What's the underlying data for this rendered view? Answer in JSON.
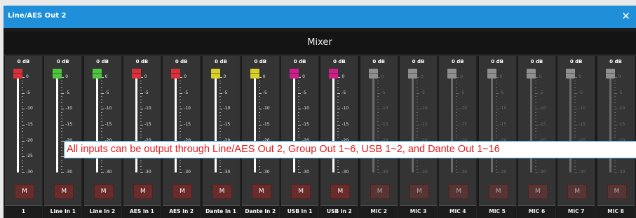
{
  "window": {
    "title": "Line/AES Out 2",
    "close_icon": "close-icon"
  },
  "mixer": {
    "title": "Mixer"
  },
  "scale_labels": [
    "0",
    "-5",
    "-10",
    "-15",
    "-20",
    "-25",
    "-30"
  ],
  "mute_label": "M",
  "note": "All inputs can be output through Line/AES Out 2, Group Out 1~6, USB 1~2, and Dante Out 1~16",
  "channels": [
    {
      "name": "1",
      "gain": "0 dB",
      "knob_color": "#d8313a",
      "active": true
    },
    {
      "name": "Line In 1",
      "gain": "0 dB",
      "knob_color": "#4ec53f",
      "active": true
    },
    {
      "name": "Line In 2",
      "gain": "0 dB",
      "knob_color": "#4ec53f",
      "active": true
    },
    {
      "name": "AES In 1",
      "gain": "0 dB",
      "knob_color": "#d8313a",
      "active": true
    },
    {
      "name": "AES In 2",
      "gain": "0 dB",
      "knob_color": "#d8313a",
      "active": true
    },
    {
      "name": "Dante In 1",
      "gain": "0 dB",
      "knob_color": "#d7cf2a",
      "active": true
    },
    {
      "name": "Dante In 2",
      "gain": "0 dB",
      "knob_color": "#d7cf2a",
      "active": true
    },
    {
      "name": "USB In 1",
      "gain": "0 dB",
      "knob_color": "#cc1f8c",
      "active": true
    },
    {
      "name": "USB In 2",
      "gain": "0 dB",
      "knob_color": "#cc1f8c",
      "active": true
    },
    {
      "name": "MIC 2",
      "gain": "0 dB",
      "knob_color": "#8f8f8f",
      "active": false
    },
    {
      "name": "MIC 3",
      "gain": "0 dB",
      "knob_color": "#8f8f8f",
      "active": false
    },
    {
      "name": "MIC 4",
      "gain": "0 dB",
      "knob_color": "#8f8f8f",
      "active": false
    },
    {
      "name": "MIC 5",
      "gain": "0 dB",
      "knob_color": "#8f8f8f",
      "active": false
    },
    {
      "name": "MIC 6",
      "gain": "0 dB",
      "knob_color": "#8f8f8f",
      "active": false
    },
    {
      "name": "MIC 7",
      "gain": "0 dB",
      "knob_color": "#8f8f8f",
      "active": false
    },
    {
      "name": "MIC 8",
      "gain": "0 dB",
      "knob_color": "#8f8f8f",
      "active": false
    }
  ]
}
